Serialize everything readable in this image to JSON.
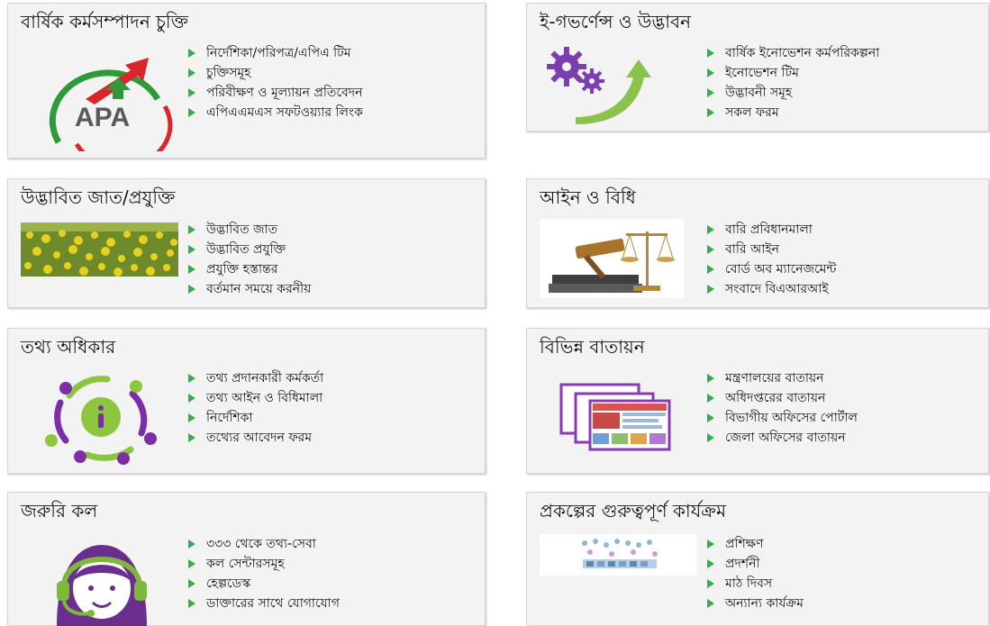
{
  "sections": [
    {
      "title": "বার্ষিক কর্মসম্পাদন চুক্তি",
      "icon": "apa-logo-icon",
      "logo_text": "APA",
      "items": [
        "নির্দেশিকা/পরিপত্র/এপিএ টিম",
        "চুক্তিসমূহ",
        "পরিবীক্ষণ ও মূল্যায়ন প্রতিবেদন",
        "এপিএএমএস সফটওয়্যার লিংক"
      ]
    },
    {
      "title": "ই-গভর্ণেন্স ও উদ্ভাবন",
      "icon": "gears-arrow-icon",
      "items": [
        "বার্ষিক ইনোভেশন কর্মপরিকল্পনা",
        "ইনোভেশন টিম",
        "উদ্ভাবনী সমূহ",
        "সকল ফরম"
      ]
    },
    {
      "title": "উদ্ভাবিত জাত/প্রযুক্তি",
      "icon": "mustard-field-image",
      "items": [
        "উদ্ভাবিত জাত",
        "উদ্ভাবিত প্রযুক্তি",
        "প্রযুক্তি হস্তান্তর",
        "বর্তমান সময়ে করনীয়"
      ]
    },
    {
      "title": "আইন ও বিধি",
      "icon": "law-scales-gavel-image",
      "items": [
        "বারি প্রবিধানমালা",
        "বারি আইন",
        "বোর্ড অব ম্যানেজমেন্ট",
        "সংবাদে বিএআরআই"
      ]
    },
    {
      "title": "তথ্য অধিকার",
      "icon": "info-people-icon",
      "items": [
        "তথ্য প্রদানকারী কর্মকর্তা",
        "তথ্য আইন ও বিধিমালা",
        "নির্দেশিকা",
        "তথ্যের আবেদন ফরম"
      ]
    },
    {
      "title": "বিভিন্ন বাতায়ন",
      "icon": "web-portals-icon",
      "items": [
        "মন্ত্রণালয়ের বাতায়ন",
        "অধিদপ্তরের বাতায়ন",
        "বিভাগীয় অফিসের পোর্টাল",
        "জেলা অফিসের বাতায়ন"
      ]
    },
    {
      "title": "জরুরি কল",
      "icon": "call-center-agent-icon",
      "items": [
        "৩৩৩ থেকে তথ্য-সেবা",
        "কল সেন্টারসমূহ",
        "হেল্পডেস্ক",
        "ডাক্তারের সাথে যোগাযোগ"
      ]
    },
    {
      "title": "প্রকল্পের গুরুত্বপূর্ণ কার্যক্রম",
      "icon": "project-infographic-image",
      "items": [
        "প্রশিক্ষণ",
        "প্রদর্শনী",
        "মাঠ দিবস",
        "অন্যান্য কার্যক্রম"
      ]
    }
  ],
  "colors": {
    "bullet": "#2fb04a",
    "box_background": "#f3f3f3",
    "apa_green": "#2f9a3a",
    "apa_red": "#d8262c",
    "egov_purple": "#7b3fb0",
    "egov_green": "#8bc34a",
    "rti_purple": "#7b2ea5",
    "rti_green": "#8cc63f"
  }
}
